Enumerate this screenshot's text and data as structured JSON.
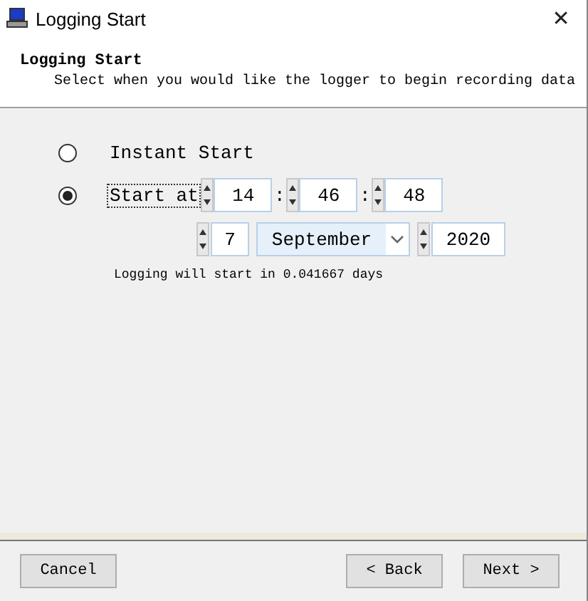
{
  "window": {
    "title": "Logging Start",
    "close": "✕"
  },
  "header": {
    "title": "Logging Start",
    "subtitle": "Select when you would like the logger to begin recording data"
  },
  "options": [
    {
      "label": "Instant Start",
      "selected": false,
      "focused": false
    },
    {
      "label": "Start at",
      "selected": true,
      "focused": true
    }
  ],
  "time": {
    "hour": "14",
    "minute": "46",
    "second": "48",
    "separator": ":"
  },
  "date": {
    "day": "7",
    "month": "September",
    "year": "2020"
  },
  "status": "Logging will start in 0.041667 days",
  "buttons": [
    {
      "label": "Cancel",
      "kind": "cancel"
    },
    {
      "label": "< Back",
      "kind": "back"
    },
    {
      "label": "Next >",
      "kind": "next"
    }
  ]
}
